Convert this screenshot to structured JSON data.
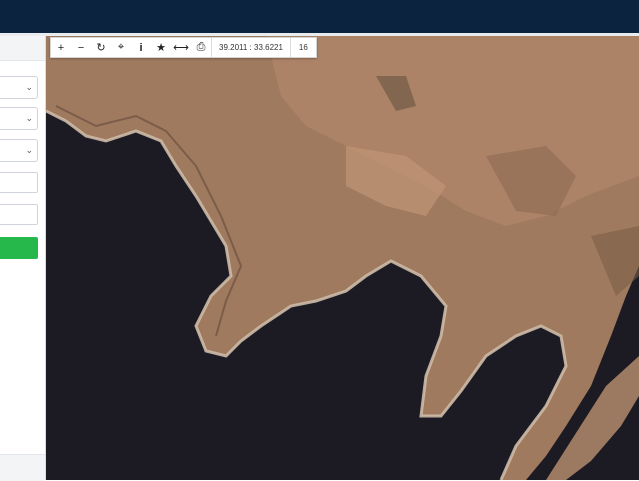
{
  "map": {
    "toolbar": {
      "zoom_in_icon": "+",
      "zoom_out_icon": "−",
      "refresh_icon": "↻",
      "locate_icon": "⌖",
      "info_icon": "i",
      "favorite_icon": "★",
      "measure_icon": "⟷",
      "print_icon": "⎙",
      "coordinates": "39.2011 : 33.6221",
      "zoom_level": "16"
    },
    "colors": {
      "water": "#1c1a22",
      "land": "#a07a5e",
      "land_dark": "#7a5e48",
      "shore": "#cdbba8"
    }
  },
  "sidebar": {
    "button_color": "#27b84b"
  }
}
